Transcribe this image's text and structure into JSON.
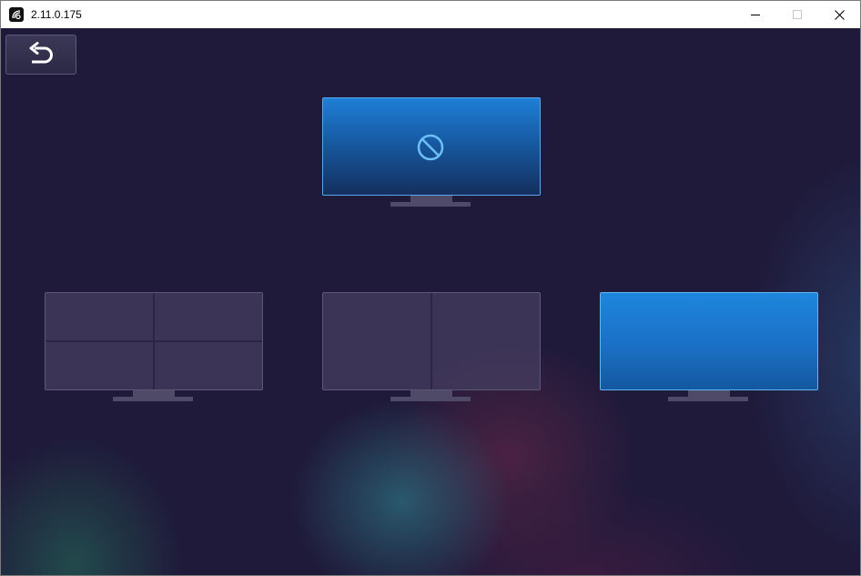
{
  "window": {
    "title": "2.11.0.175",
    "app_icon": "app-logo-icon",
    "controls": [
      "minimize-icon",
      "maximize-icon",
      "close-icon"
    ]
  },
  "toolbar": {
    "back_icon": "undo-arrow-icon"
  },
  "layouts": [
    {
      "id": "disabled-single",
      "state": "selected",
      "icon": "no-entry-icon",
      "accent": "#1e7fd6"
    },
    {
      "id": "quad-split",
      "state": "available",
      "panes": 4
    },
    {
      "id": "dual-split",
      "state": "available",
      "panes": 2
    },
    {
      "id": "single-full",
      "state": "available",
      "panes": 1,
      "accent": "#1e86de"
    }
  ],
  "colors": {
    "background": "#1f1a3a",
    "accent_blue": "#1e7fd6",
    "inactive_screen": "#463e60",
    "stand": "#4e4a68"
  }
}
